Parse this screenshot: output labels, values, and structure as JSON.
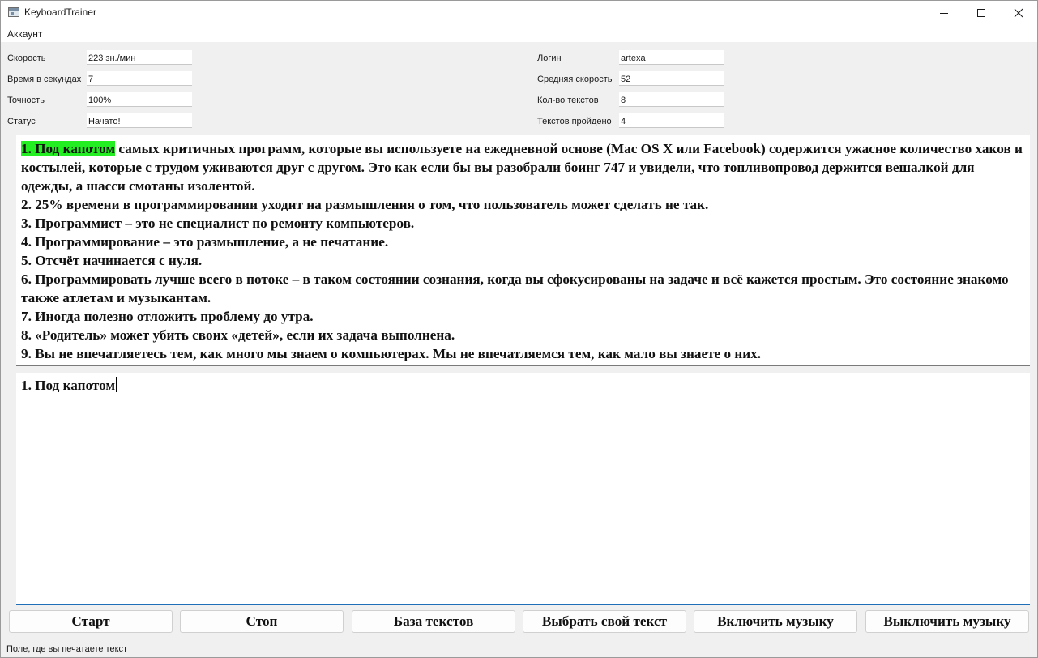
{
  "window": {
    "title": "KeyboardTrainer",
    "icon": "app-window-icon"
  },
  "menu": {
    "account": "Аккаунт"
  },
  "stats_left": [
    {
      "label": "Скорость",
      "value": "223 зн./мин"
    },
    {
      "label": "Время в секундах",
      "value": "7"
    },
    {
      "label": "Точность",
      "value": "100%"
    },
    {
      "label": "Статус",
      "value": "Начато!"
    }
  ],
  "stats_right": [
    {
      "label": "Логин",
      "value": "artexa"
    },
    {
      "label": "Средняя скорость",
      "value": "52"
    },
    {
      "label": "Кол-во текстов",
      "value": "8"
    },
    {
      "label": "Текстов пройдено",
      "value": "4"
    }
  ],
  "source_text": {
    "highlighted": "1. Под капотом",
    "line1_rest": " самых критичных программ, которые вы используете на ежедневной основе (Mac OS X или Facebook) содержится ужасное количество хаков и костылей, которые с трудом уживаются друг с другом. Это как если бы вы разобрали боинг 747 и увидели, что топливопровод держится вешалкой для одежды, а шасси смотаны изолентой.",
    "items": [
      "2. 25% времени в программировании уходит на размышления о том, что пользователь может сделать не так.",
      "3. Программист – это не специалист по ремонту компьютеров.",
      "4. Программирование – это размышление, а не печатание.",
      "5. Отсчёт начинается с нуля.",
      "6. Программировать лучше всего в потоке – в таком состоянии сознания, когда вы сфокусированы на задаче и всё кажется простым. Это состояние знакомо также атлетам и музыкантам.",
      "7. Иногда полезно отложить проблему до утра.",
      "8. «Родитель» может убить своих «детей», если их задача выполнена.",
      "9. Вы не впечатляетесь тем, как много мы знаем о компьютерах. Мы не впечатляемся тем, как мало вы знаете о них."
    ],
    "highlight_color": "#22ee22"
  },
  "typing": {
    "value": "1. Под капотом"
  },
  "buttons": {
    "start": "Старт",
    "stop": "Стоп",
    "text_base": "База текстов",
    "choose_text": "Выбрать свой текст",
    "music_on": "Включить музыку",
    "music_off": "Выключить музыку"
  },
  "status_bar": {
    "text": "Поле, где вы печатаете текст"
  },
  "colors": {
    "accent": "#1f6fb8",
    "highlight": "#22ee22"
  }
}
